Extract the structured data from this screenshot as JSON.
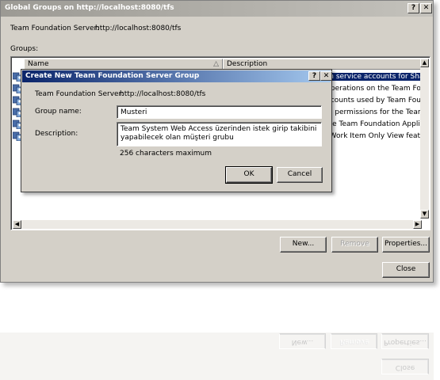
{
  "window": {
    "title": "Global Groups on http://localhost:8080/tfs",
    "help_glyph": "?",
    "close_glyph": "✕"
  },
  "server": {
    "label": "Team Foundation Server:",
    "value": "http://localhost:8080/tfs"
  },
  "groups": {
    "label": "Groups:",
    "columns": [
      "Name",
      "Description"
    ],
    "rows": [
      {
        "description": "ntain service accounts for Share",
        "selected": true
      },
      {
        "description": "all operations on the Team Founc",
        "selected": false
      },
      {
        "description": "e accounts used by Team Founc",
        "selected": false
      },
      {
        "description": "level permissions for the Team F",
        "selected": false
      },
      {
        "description": "to the Team Foundation Applicat",
        "selected": false
      },
      {
        "description": "the Work Item Only View featur",
        "selected": false
      }
    ]
  },
  "buttons": {
    "new": "New...",
    "remove": "Remove",
    "properties": "Properties...",
    "close": "Close"
  },
  "dialog": {
    "title": "Create New Team Foundation Server Group",
    "help_glyph": "?",
    "close_glyph": "✕",
    "server_label": "Team Foundation Server:",
    "server_value": "http://localhost:8080/tfs",
    "group_name_label": "Group name:",
    "group_name_value": "Musteri",
    "description_label": "Description:",
    "description_value": "Team System Web Access üzerinden istek girip takibini\nyapabilecek olan müşteri grubu",
    "chars_info": "256 characters maximum",
    "ok": "OK",
    "cancel": "Cancel"
  },
  "colors": {
    "window_bg": "#d4d0c8",
    "active_title": "#0a246a",
    "selection": "#0a246a"
  }
}
